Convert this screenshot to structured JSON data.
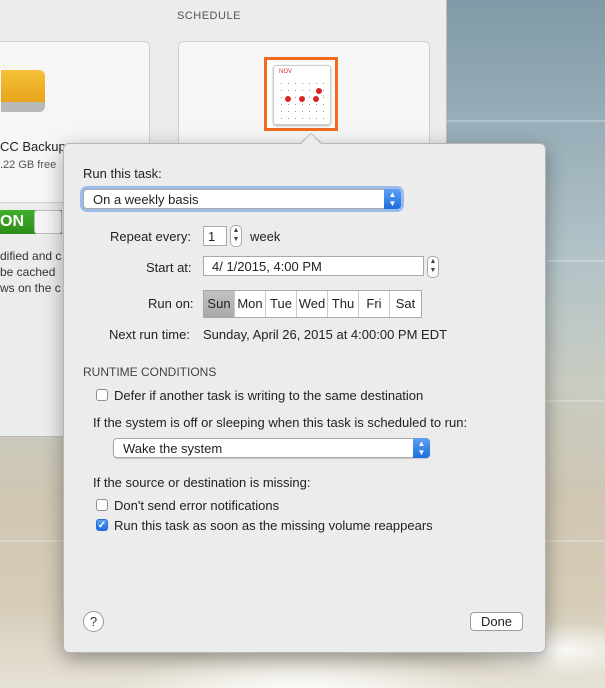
{
  "window": {
    "schedule_heading": "SCHEDULE",
    "destination_name": "CC Backup",
    "destination_free": ".22 GB free",
    "switch_label": "ON",
    "partial_text": [
      "dified and c",
      "be cached",
      "ws on the c"
    ],
    "schedule_icon_month": "NOV"
  },
  "popover": {
    "run_label": "Run this task:",
    "frequency": "On a weekly basis",
    "repeat_label": "Repeat every:",
    "repeat_value": "1",
    "repeat_unit": "week",
    "start_label": "Start at:",
    "start_value": "4/  1/2015,   4:00 PM",
    "run_on_label": "Run on:",
    "days": [
      {
        "label": "Sun",
        "selected": true
      },
      {
        "label": "Mon",
        "selected": false
      },
      {
        "label": "Tue",
        "selected": false
      },
      {
        "label": "Wed",
        "selected": false
      },
      {
        "label": "Thu",
        "selected": false
      },
      {
        "label": "Fri",
        "selected": false
      },
      {
        "label": "Sat",
        "selected": false
      }
    ],
    "next_run_label": "Next run time:",
    "next_run_value": "Sunday, April 26, 2015 at 4:00:00 PM EDT",
    "runtime_heading": "RUNTIME CONDITIONS",
    "defer_label": "Defer if another task is writing to the same destination",
    "defer_checked": false,
    "system_off_label": "If the system is off or sleeping when this task is scheduled to run:",
    "system_off_value": "Wake the system",
    "missing_label": "If the source or destination is missing:",
    "no_errors_label": "Don't send error notifications",
    "no_errors_checked": false,
    "run_on_reappear_label": "Run this task as soon as the missing volume reappears",
    "run_on_reappear_checked": true,
    "help_label": "?",
    "done_label": "Done"
  },
  "colors": {
    "accent": "#1c6fe0",
    "highlight": "#f06a22",
    "switch_on": "#3fae2a"
  }
}
